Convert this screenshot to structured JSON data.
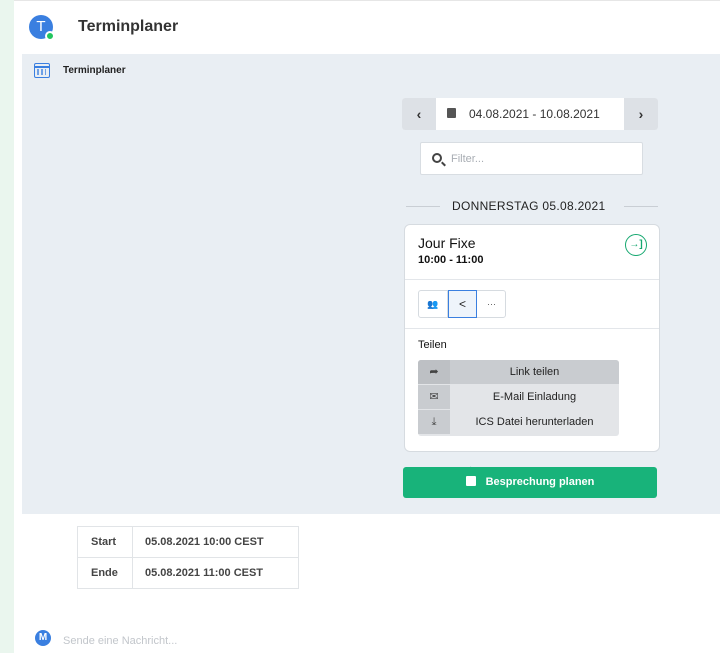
{
  "header": {
    "avatar_letter": "T",
    "title": "Terminplaner"
  },
  "widget": {
    "title": "Terminplaner",
    "date_nav": {
      "prev_symbol": "‹",
      "next_symbol": "›",
      "range": "04.08.2021 - 10.08.2021"
    },
    "filter": {
      "placeholder": "Filter..."
    },
    "day_label": "DONNERSTAG 05.08.2021",
    "event": {
      "title": "Jour Fixe",
      "time": "10:00 - 11:00",
      "tabs": [
        {
          "name": "participants",
          "symbol": "👥"
        },
        {
          "name": "share",
          "symbol": "<"
        },
        {
          "name": "more",
          "symbol": "···"
        }
      ],
      "share_heading": "Teilen",
      "share_menu": [
        {
          "label": "Link teilen",
          "icon": "share-arrow-icon",
          "symbol": "➦"
        },
        {
          "label": "E-Mail Einladung",
          "icon": "envelope-icon",
          "symbol": "✉"
        },
        {
          "label": "ICS Datei herunterladen",
          "icon": "download-icon",
          "symbol": "⤓"
        }
      ]
    },
    "plan_button": "Besprechung planen"
  },
  "times_table": [
    {
      "key": "Start",
      "value": "05.08.2021 10:00 CEST"
    },
    {
      "key": "Ende",
      "value": "05.08.2021 11:00 CEST"
    }
  ],
  "composer": {
    "avatar_letter": "M",
    "placeholder": "Sende eine Nachricht..."
  },
  "colors": {
    "accent_blue": "#3a7fe0",
    "accent_green": "#18b37a",
    "panel_bg": "#e9eef3"
  }
}
